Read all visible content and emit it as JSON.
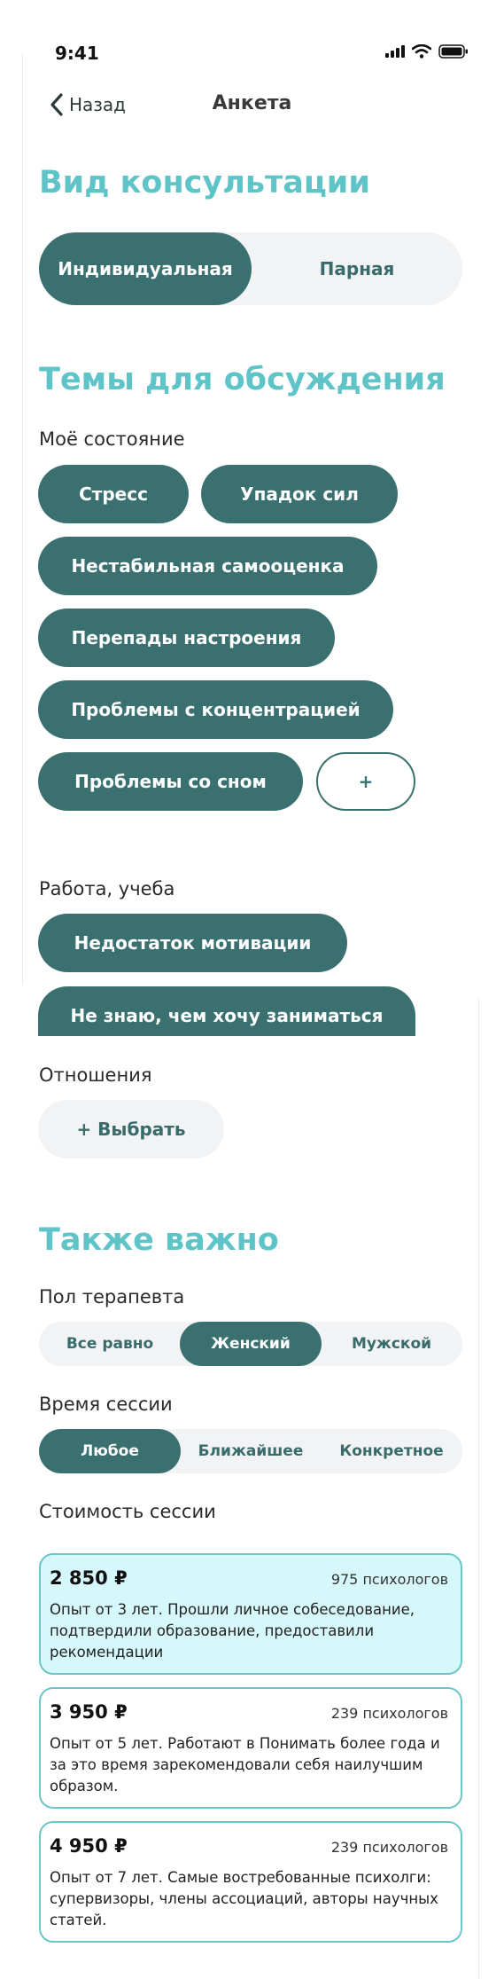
{
  "status": {
    "time": "9:41"
  },
  "nav": {
    "back_label": "Назад",
    "title": "Анкета"
  },
  "consultation": {
    "title": "Вид консультации",
    "options": [
      "Индивидуальная",
      "Парная"
    ],
    "selected": "Индивидуальная"
  },
  "topics": {
    "title": "Темы для обсуждения",
    "state": {
      "label": "Моё состояние",
      "chips": [
        "Стресс",
        "Упадок сил",
        "Нестабильная самооценка",
        "Перепады настроения",
        "Проблемы с концентрацией",
        "Проблемы со сном"
      ],
      "add_label": "+"
    },
    "work": {
      "label": "Работа, учеба",
      "chips": [
        "Недостаток мотивации",
        "Не знаю, чем хочу заниматься"
      ]
    },
    "relations": {
      "label": "Отношения",
      "choose_label": "+ Выбрать"
    }
  },
  "important": {
    "title": "Также важно",
    "gender": {
      "label": "Пол терапевта",
      "options": [
        "Все равно",
        "Женский",
        "Мужской"
      ],
      "selected": "Женский"
    },
    "time": {
      "label": "Время сессии",
      "options": [
        "Любое",
        "Ближайшее",
        "Конкретное"
      ],
      "selected": "Любое"
    },
    "cost": {
      "label": "Стоимость сессии",
      "cards": [
        {
          "price": "2 850 ₽",
          "count": "975 психологов",
          "description": "Опыт от 3 лет. Прошли личное собеседование, подтвердили образование, предоставили рекомендации",
          "selected": true
        },
        {
          "price": "3 950 ₽",
          "count": "239 психологов",
          "description": "Опыт от 5 лет. Работают в Понимать более года и за это время зарекомендовали себя наилучшим образом.",
          "selected": false
        },
        {
          "price": "4 950 ₽",
          "count": "239 психологов",
          "description": "Опыт от 7 лет. Самые востребованные психолги: супервизоры, члены ассоциаций, авторы научных статей.",
          "selected": false
        }
      ]
    }
  },
  "colors": {
    "accent": "#5fc4c8",
    "primary": "#3a7170",
    "card_selected": "#d6f8fa",
    "segment_bg": "#f1f3f4"
  }
}
